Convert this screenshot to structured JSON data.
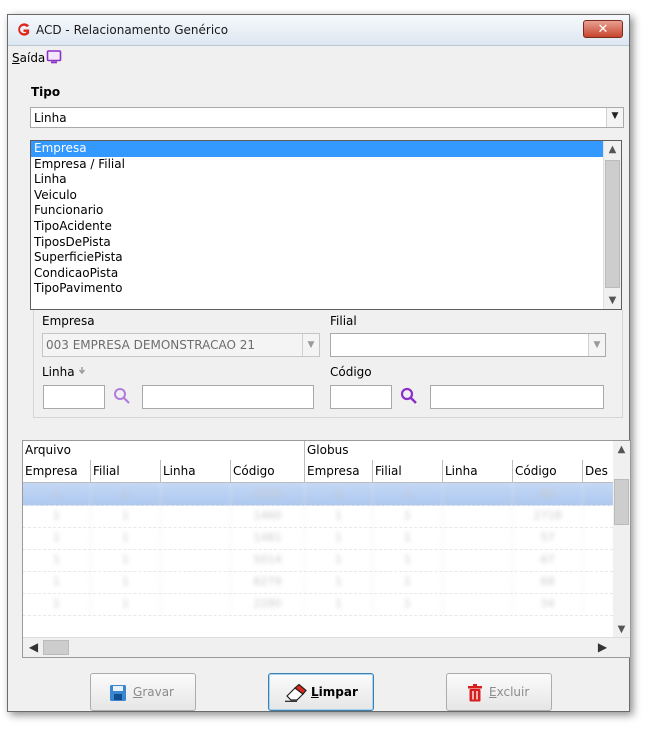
{
  "window": {
    "title": "ACD - Relacionamento Genérico",
    "close_glyph": "✕"
  },
  "menu": {
    "saida_mnemonic": "S",
    "saida_rest": "aída",
    "monitor_icon": "monitor-icon"
  },
  "tipo": {
    "label": "Tipo",
    "selected": "Linha",
    "options": [
      "Empresa",
      "Empresa / Filial",
      "Linha",
      "Veiculo",
      "Funcionario",
      "TipoAcidente",
      "TiposDePista",
      "SuperficiePista",
      "CondicaoPista",
      "TipoPavimento"
    ],
    "highlighted_index": 0
  },
  "form": {
    "empresa_label": "Empresa",
    "empresa_value": "003 EMPRESA DEMONSTRACAO 21",
    "filial_label": "Filial",
    "filial_value": "",
    "linha_label": "Linha",
    "codigo_label": "Código"
  },
  "grid": {
    "bands": [
      "Arquivo",
      "Globus"
    ],
    "columns": [
      "Empresa",
      "Filial",
      "Linha",
      "Código",
      "Empresa",
      "Filial",
      "Linha",
      "Código",
      "Des"
    ],
    "rows": [
      [
        "1",
        "1",
        "",
        "2315",
        "1",
        "1",
        "",
        "60",
        ""
      ],
      [
        "1",
        "1",
        "",
        "1460",
        "1",
        "1",
        "",
        "2718",
        ""
      ],
      [
        "1",
        "1",
        "",
        "1481",
        "1",
        "1",
        "",
        "57",
        ""
      ],
      [
        "1",
        "1",
        "",
        "5014",
        "1",
        "1",
        "",
        "67",
        ""
      ],
      [
        "1",
        "1",
        "",
        "6279",
        "1",
        "1",
        "",
        "68",
        ""
      ],
      [
        "1",
        "1",
        "",
        "2280",
        "1",
        "1",
        "",
        "34",
        ""
      ]
    ],
    "selected_row": 0
  },
  "buttons": {
    "gravar_mn": "G",
    "gravar_rest": "ravar",
    "limpar_mn": "L",
    "limpar_rest": "impar",
    "excluir_mn": "E",
    "excluir_rest": "xcluir"
  },
  "colors": {
    "accent_selection": "#3399ff",
    "logo_red": "#e0261c",
    "monitor_purple": "#8b2fc9"
  }
}
